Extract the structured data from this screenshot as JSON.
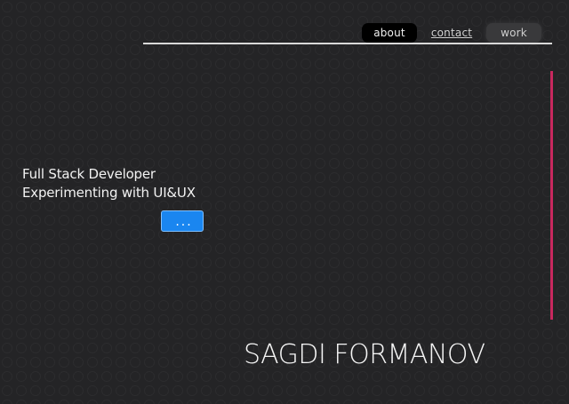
{
  "nav": {
    "items": [
      {
        "label": "about"
      },
      {
        "label": "contact"
      },
      {
        "label": "work"
      }
    ]
  },
  "hero": {
    "tagline_line1": "Full Stack Developer",
    "tagline_line2": "Experimenting with UI&UX",
    "more_button_label": "..."
  },
  "footer": {
    "name": "SAGDI FORMANOV"
  },
  "colors": {
    "background": "#242426",
    "accent_bar": "#c8285e",
    "button": "#1a86f0",
    "divider": "#d9d9d9"
  }
}
